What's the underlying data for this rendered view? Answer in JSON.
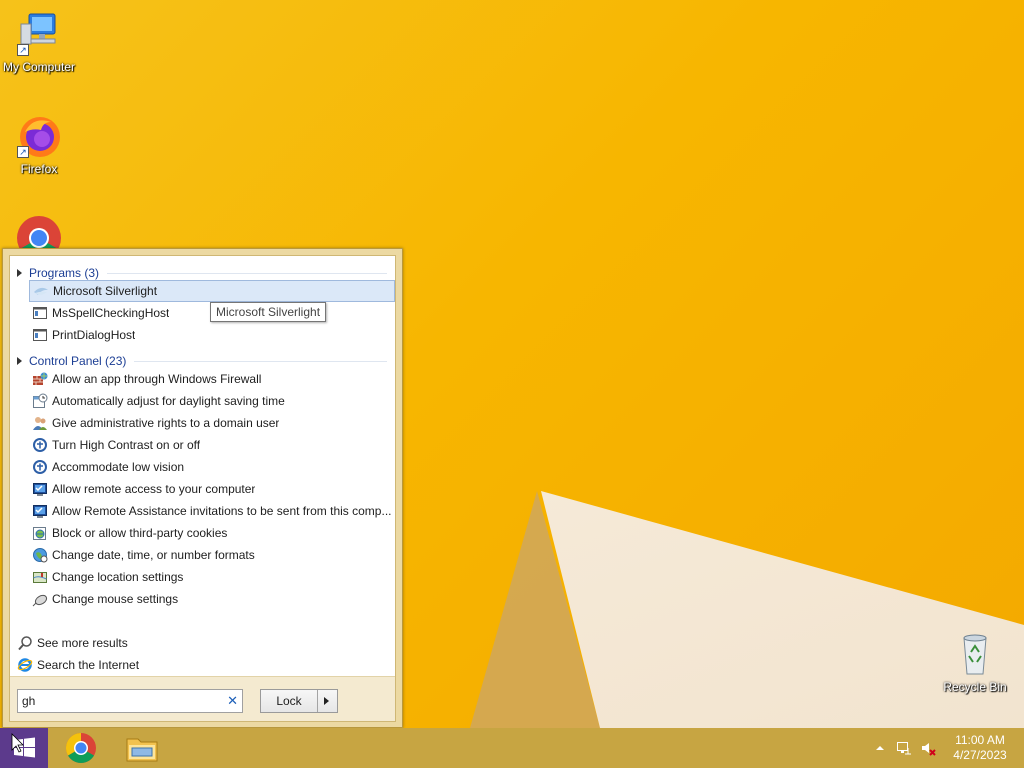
{
  "desktop": {
    "icons": [
      {
        "label": "My Computer",
        "icon": "computer-icon"
      },
      {
        "label": "Firefox",
        "icon": "firefox-icon"
      },
      {
        "label": "",
        "icon": "chrome-icon"
      },
      {
        "label": "Recycle Bin",
        "icon": "recycle-bin-icon"
      }
    ]
  },
  "start_menu": {
    "programs_header": "Programs (3)",
    "programs": [
      {
        "label": "Microsoft Silverlight",
        "icon": "silverlight-icon",
        "selected": true
      },
      {
        "label": "MsSpellCheckingHost",
        "icon": "app-window-icon"
      },
      {
        "label": "PrintDialogHost",
        "icon": "app-window-icon"
      }
    ],
    "control_panel_header": "Control Panel (23)",
    "control_panel": [
      {
        "label": "Allow an app through Windows Firewall",
        "icon": "firewall-icon"
      },
      {
        "label": "Automatically adjust for daylight saving time",
        "icon": "calendar-clock-icon"
      },
      {
        "label": "Give administrative rights to a domain user",
        "icon": "users-icon"
      },
      {
        "label": "Turn High Contrast on or off",
        "icon": "ease-of-access-icon"
      },
      {
        "label": "Accommodate low vision",
        "icon": "ease-of-access-icon"
      },
      {
        "label": "Allow remote access to your computer",
        "icon": "system-shield-icon"
      },
      {
        "label": "Allow Remote Assistance invitations to be sent from this comp...",
        "icon": "system-shield-icon"
      },
      {
        "label": "Block or allow third-party cookies",
        "icon": "internet-options-icon"
      },
      {
        "label": "Change date, time, or number formats",
        "icon": "region-icon"
      },
      {
        "label": "Change location settings",
        "icon": "location-icon"
      },
      {
        "label": "Change mouse settings",
        "icon": "mouse-icon"
      }
    ],
    "see_more": "See more results",
    "search_internet": "Search the Internet",
    "search": {
      "value": "gh",
      "clear_glyph": "✕"
    },
    "lock_label": "Lock",
    "tooltip": "Microsoft Silverlight"
  },
  "taskbar": {
    "pinned": [
      {
        "icon": "chrome-icon"
      },
      {
        "icon": "file-explorer-icon"
      }
    ],
    "clock": {
      "time": "11:00 AM",
      "date": "4/27/2023"
    }
  },
  "colors": {
    "accent": "#1c3e94",
    "wallpaper": "#f7b600",
    "start_button": "#5c3a8c"
  }
}
